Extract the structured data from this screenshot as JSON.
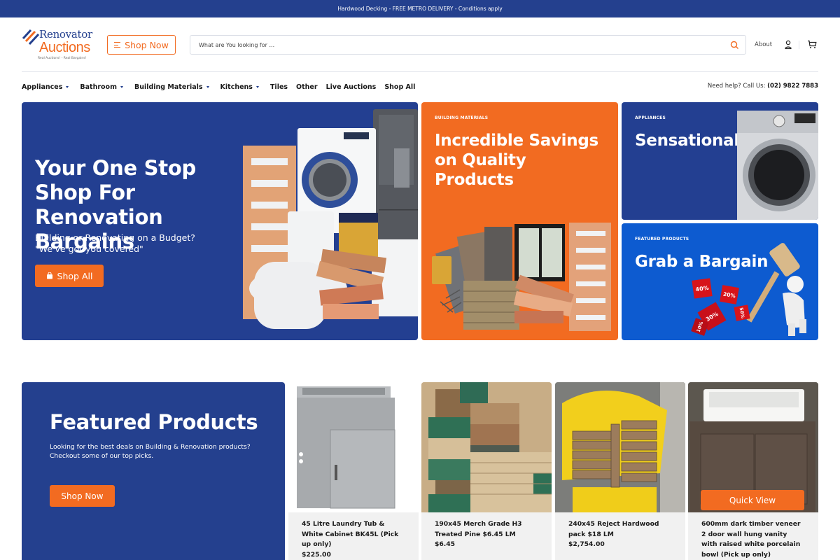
{
  "announcement": "Hardwood Decking - FREE METRO DELIVERY - Conditions apply",
  "brand": {
    "name_line1": "Renovator",
    "name_line2": "Auctions",
    "tagline": "Real Auctions! - Real Bargains!"
  },
  "header": {
    "shop_now_label": "Shop Now",
    "search_placeholder": "What are You looking for ...",
    "search_value": "",
    "about_label": "About",
    "icons": [
      "menu-icon",
      "search-icon",
      "user-icon",
      "cart-icon"
    ]
  },
  "nav": {
    "items": [
      {
        "label": "Appliances",
        "has_dropdown": true
      },
      {
        "label": "Bathroom",
        "has_dropdown": true
      },
      {
        "label": "Building Materials",
        "has_dropdown": true
      },
      {
        "label": "Kitchens",
        "has_dropdown": true
      },
      {
        "label": "Tiles",
        "has_dropdown": false
      },
      {
        "label": "Other",
        "has_dropdown": false
      },
      {
        "label": "Live Auctions",
        "has_dropdown": false
      },
      {
        "label": "Shop All",
        "has_dropdown": false
      }
    ],
    "help_text": "Need help? Call Us:",
    "phone": "(02) 9822 7883"
  },
  "hero": {
    "main": {
      "title": "Your One Stop Shop For Renovation Bargains",
      "subtitle_line1": "Building or Renovating on a Budget?",
      "subtitle_line2": "\"We've got you covered\"",
      "button_label": "Shop All"
    },
    "building_materials": {
      "kicker": "BUILDING MATERIALS",
      "title": "Incredible Savings on Quality Products"
    },
    "appliances": {
      "kicker": "APPLIANCES",
      "title": "Sensational Savings"
    },
    "featured": {
      "kicker": "FEATURED PRODUCTS",
      "title": "Grab a Bargain",
      "discount_tags": [
        "40%",
        "20%",
        "30%",
        "50%",
        "10%"
      ]
    }
  },
  "featured_section": {
    "title": "Featured Products",
    "description": "Looking for the best deals on Building & Renovation products? Checkout some of our top picks.",
    "button_label": "Shop Now",
    "quick_view_label": "Quick View",
    "products": [
      {
        "name": "45 Litre Laundry Tub & White Cabinet BK45L (Pick up only)",
        "price": "$225.00"
      },
      {
        "name": "190x45 Merch Grade H3 Treated Pine $6.45 LM",
        "price": "$6.45"
      },
      {
        "name": "240x45 Reject Hardwood pack $18 LM",
        "price": "$2,754.00"
      },
      {
        "name": "600mm dark timber veneer 2 door wall hung vanity with raised white porcelain bowl (Pick up only)",
        "price": ""
      }
    ]
  },
  "colors": {
    "brand_blue": "#24408e",
    "accent_orange": "#f26b21",
    "bright_blue": "#0d5bd0",
    "card_info_bg": "#f1f1f1"
  }
}
